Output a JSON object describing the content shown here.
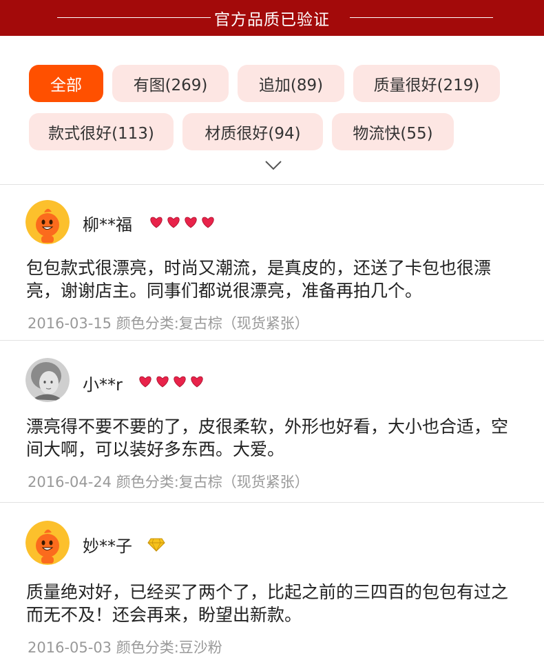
{
  "banner": {
    "title": "官方品质已验证"
  },
  "filters": [
    {
      "label": "全部",
      "active": true
    },
    {
      "label": "有图(269)",
      "active": false
    },
    {
      "label": "追加(89)",
      "active": false
    },
    {
      "label": "质量很好(219)",
      "active": false
    },
    {
      "label": "款式很好(113)",
      "active": false
    },
    {
      "label": "材质很好(94)",
      "active": false
    },
    {
      "label": "物流快(55)",
      "active": false
    }
  ],
  "reviews": [
    {
      "username": "柳**福",
      "badge": "heart-level-icon",
      "badge_count": 4,
      "text": "包包款式很漂亮，时尚又潮流，是真皮的，还送了卡包也很漂亮，谢谢店主。同事们都说很漂亮，准备再拍几个。",
      "date": "2016-03-15",
      "variant": "颜色分类:复古棕（现货紧张）"
    },
    {
      "username": "小**r",
      "badge": "heart-level-icon",
      "badge_count": 4,
      "text": "漂亮得不要不要的了，皮很柔软，外形也好看，大小也合适，空间大啊，可以装好多东西。大爱。",
      "date": "2016-04-24",
      "variant": "颜色分类:复古棕（现货紧张）"
    },
    {
      "username": "妙**子",
      "badge": "diamond-level-icon",
      "badge_count": 1,
      "text": "质量绝对好，已经买了两个了，比起之前的三四百的包包有过之而无不及！还会再来，盼望出新款。",
      "date": "2016-05-03",
      "variant": "颜色分类:豆沙粉"
    }
  ],
  "colors": {
    "banner": "#a30a0a",
    "active_tag": "#ff5000",
    "tag_bg": "#fde6e3",
    "meta_text": "#999999"
  }
}
